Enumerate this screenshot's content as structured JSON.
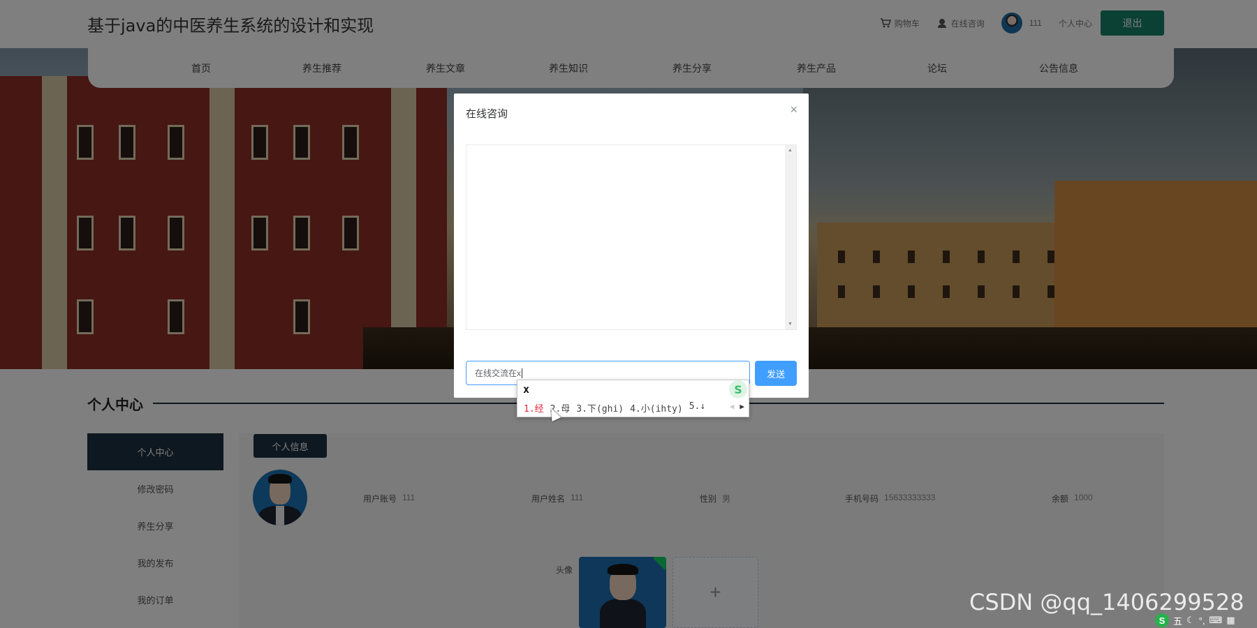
{
  "header": {
    "site_title": "基于java的中医养生系统的设计和实现",
    "cart": "购物车",
    "online_consult": "在线咨询",
    "username": "111",
    "personal_center": "个人中心",
    "logout": "退出"
  },
  "nav": {
    "items": [
      "首页",
      "养生推荐",
      "养生文章",
      "养生知识",
      "养生分享",
      "养生产品",
      "论坛",
      "公告信息"
    ]
  },
  "section": {
    "title": "个人中心"
  },
  "sidebar": {
    "items": [
      "个人中心",
      "修改密码",
      "养生分享",
      "我的发布",
      "我的订单"
    ],
    "active_index": 0
  },
  "profile": {
    "badge": "个人信息",
    "fields": [
      {
        "label": "用户账号",
        "value": "111"
      },
      {
        "label": "用户姓名",
        "value": "111"
      },
      {
        "label": "性别",
        "value": "男"
      },
      {
        "label": "手机号码",
        "value": "15633333333"
      },
      {
        "label": "余额",
        "value": "1000"
      }
    ],
    "avatar_label": "头像",
    "add_symbol": "+"
  },
  "modal": {
    "title": "在线咨询",
    "close_symbol": "×",
    "input_value": "在线交流在x",
    "send": "发送"
  },
  "ime": {
    "composition": "x",
    "logo": "S",
    "candidates": [
      "1.经",
      "2.母",
      "3.下(ghi)",
      "4.小(ihty)",
      "5.↓"
    ],
    "selected_index": 0
  },
  "watermark": "CSDN @qq_1406299528",
  "tray": {
    "logo": "S",
    "mode": "五"
  },
  "colors": {
    "primary_dark": "#1d3140",
    "logout_green": "#17806a",
    "send_blue": "#409eff",
    "ime_selected": "#e0283d"
  }
}
